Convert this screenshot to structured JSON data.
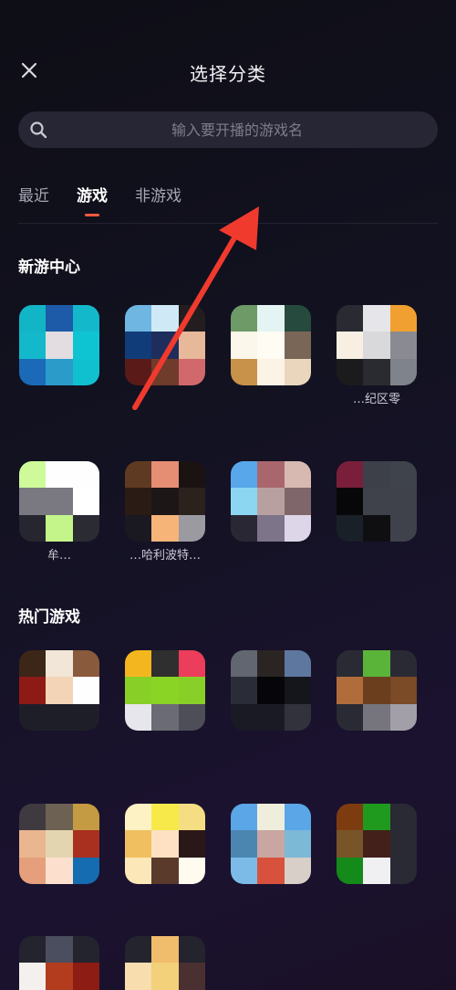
{
  "header": {
    "title": "选择分类",
    "close_icon": "close-icon"
  },
  "search": {
    "placeholder": "输入要开播的游戏名",
    "value": ""
  },
  "tabs": [
    {
      "label": "最近",
      "active": false
    },
    {
      "label": "游戏",
      "active": true
    },
    {
      "label": "非游戏",
      "active": false
    }
  ],
  "accent_color": "#ff5a3c",
  "sections": {
    "new_games": {
      "title": "新游中心"
    },
    "hot_games": {
      "title": "热门游戏"
    }
  },
  "new_games": [
    {
      "name": "",
      "colors": [
        "#12b5c6",
        "#1d5aa8",
        "#14b8cb",
        "#14b8cb",
        "#e3dde2",
        "#0fc4d2",
        "#1a6ab8",
        "#2b9bc9",
        "#11c0cf"
      ]
    },
    {
      "name": "",
      "colors": [
        "#6fb6e3",
        "#cfe9f7",
        "#241d20",
        "#103c7a",
        "#1e2d5b",
        "#e8b89a",
        "#5a1b18",
        "#6f3b2a",
        "#d0686c"
      ]
    },
    {
      "name": "",
      "colors": [
        "#6e9a68",
        "#e3f4f2",
        "#274a3e",
        "#fbf7ea",
        "#fffcf4",
        "#7a6657",
        "#c8924a",
        "#fbf3e6",
        "#e9d6bd"
      ]
    },
    {
      "name": "…纪区零",
      "colors": [
        "#2a2a32",
        "#e6e6ea",
        "#f0a030",
        "#f7f0e2",
        "#d9d9dc",
        "#8a8a92",
        "#1b1b1e",
        "#2a2b30",
        "#7f838c"
      ]
    },
    {
      "name": "牟…",
      "colors": [
        "#cffa9a",
        "#fefefe",
        "#fefefe",
        "#7a7880",
        "#7a7880",
        "#ffffff",
        "#262630",
        "#c4f58b",
        "#2b2b34"
      ]
    },
    {
      "name": "…哈利波特…",
      "colors": [
        "#5f3a22",
        "#e58e73",
        "#1b1212",
        "#2a1c15",
        "#1d1616",
        "#2c221d",
        "#1a1820",
        "#f6b479",
        "#9a9aa0"
      ]
    },
    {
      "name": "",
      "colors": [
        "#58a7ea",
        "#a9676d",
        "#d8b9b1",
        "#8dd6f2",
        "#b9a0a0",
        "#7e666a",
        "#2a2734",
        "#7d7489",
        "#dcd6e8"
      ]
    },
    {
      "name": "",
      "colors": [
        "#7a1f3b",
        "#3e4049",
        "#3f434c",
        "#07070a",
        "#3f414b",
        "#3f414b",
        "#1a2028",
        "#0f0f12",
        "#3f414b"
      ]
    }
  ],
  "hot_games": [
    {
      "name": "",
      "colors": [
        "#3b2617",
        "#f2e6d8",
        "#8a5a3c",
        "#8e1a16",
        "#f3d4b6",
        "#fefefe",
        "#1e1e28",
        "#1e1e28",
        "#1e1e28"
      ]
    },
    {
      "name": "",
      "colors": [
        "#f4b61e",
        "#2f2f2f",
        "#ec3d5b",
        "#88cf27",
        "#8ad426",
        "#88cf27",
        "#e6e6ec",
        "#6b6b75",
        "#4e4e58"
      ]
    },
    {
      "name": "",
      "colors": [
        "#616670",
        "#2a2423",
        "#5e779f",
        "#2a2d38",
        "#05050a",
        "#15151c",
        "#1a1a24",
        "#1a1a24",
        "#32323c"
      ]
    },
    {
      "name": "",
      "colors": [
        "#2a2a34",
        "#5ab43a",
        "#2a2a34",
        "#b06d3b",
        "#6b3e1e",
        "#7b4a26",
        "#2a2a34",
        "#76757d",
        "#a29fa8"
      ]
    },
    {
      "name": "",
      "colors": [
        "#3e3a40",
        "#6c6152",
        "#c49a42",
        "#e9b68f",
        "#e2d5b0",
        "#a92f1e",
        "#e59f7c",
        "#fce0cd",
        "#156cb0"
      ]
    },
    {
      "name": "",
      "colors": [
        "#fdf2c4",
        "#f7e94a",
        "#f5dd83",
        "#f0c060",
        "#fde1c2",
        "#2a1818",
        "#fce7b8",
        "#5a3a2a",
        "#fffbef"
      ]
    },
    {
      "name": "",
      "colors": [
        "#5aa6e6",
        "#efeedc",
        "#5aa6e6",
        "#4b86b0",
        "#c9a6a2",
        "#7cb9d6",
        "#7cbbe8",
        "#d8513c",
        "#d8cfc8"
      ]
    },
    {
      "name": "",
      "colors": [
        "#7d3c10",
        "#1f9a1f",
        "#2a2a34",
        "#785429",
        "#43201a",
        "#2a2a34",
        "#138a1a",
        "#f0f0f2",
        "#2a2a34"
      ]
    },
    {
      "name": "",
      "colors": [
        "#24242e",
        "#4a4e5e",
        "#24242e",
        "#f3f0ee",
        "#b43c1e",
        "#8c1c14",
        "#1e1e28",
        "#1e1e28",
        "#1e1e28"
      ]
    },
    {
      "name": "",
      "colors": [
        "#24242e",
        "#f0bd6c",
        "#24242e",
        "#f8ddaf",
        "#f3d07a",
        "#4a3030",
        "#1e1e28",
        "#1e1e28",
        "#1e1e28"
      ]
    }
  ]
}
